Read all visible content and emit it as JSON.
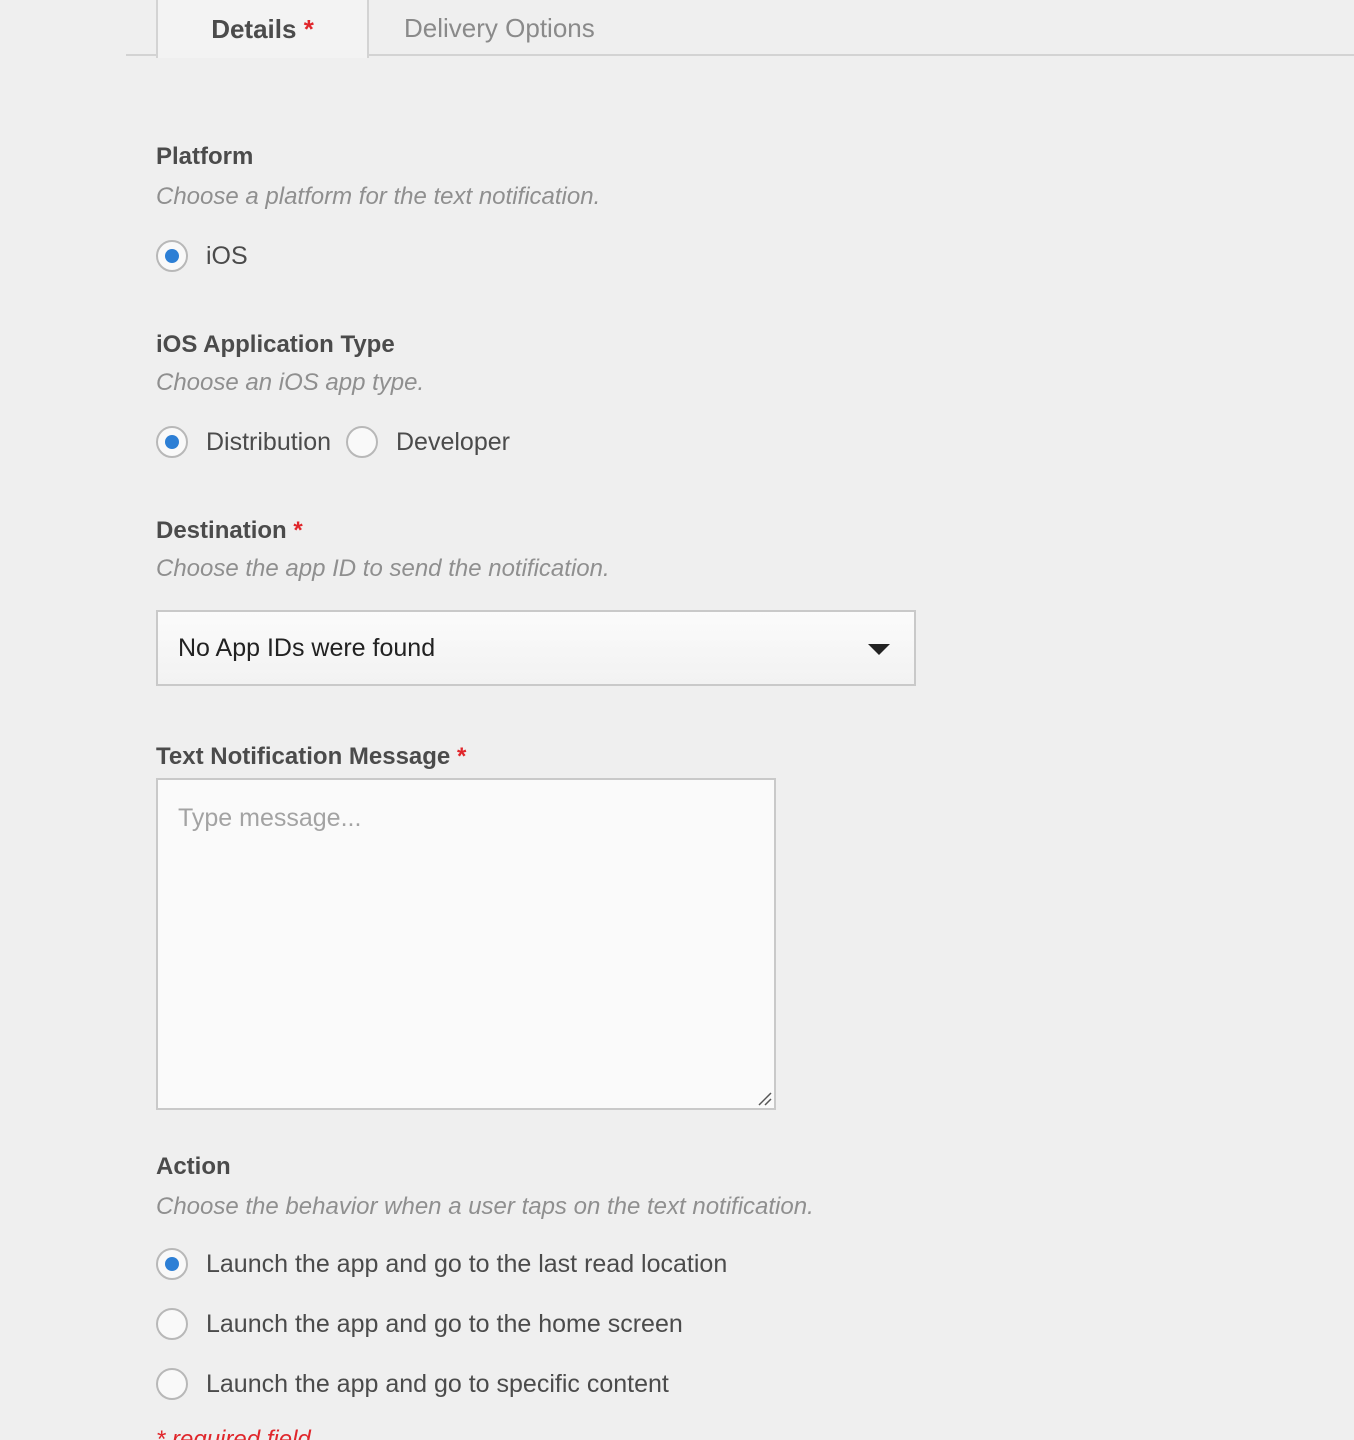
{
  "tabs": {
    "details_label": "Details",
    "details_required": "*",
    "delivery_label": "Delivery Options"
  },
  "platform": {
    "title": "Platform",
    "description": "Choose a platform for the text notification.",
    "options": [
      {
        "label": "iOS",
        "checked": true
      }
    ]
  },
  "app_type": {
    "title": "iOS Application Type",
    "description": "Choose an iOS app type.",
    "options": [
      {
        "label": "Distribution",
        "checked": true
      },
      {
        "label": "Developer",
        "checked": false
      }
    ]
  },
  "destination": {
    "title": "Destination",
    "required": "*",
    "description": "Choose the app ID to send the notification.",
    "selected_value": "No App IDs were found"
  },
  "message": {
    "title": "Text Notification Message",
    "required": "*",
    "value": "",
    "placeholder": "Type message..."
  },
  "action": {
    "title": "Action",
    "description": "Choose the behavior when a user taps on the text notification.",
    "options": [
      {
        "label": "Launch the app and go to the last read location",
        "checked": true
      },
      {
        "label": "Launch the app and go to the home screen",
        "checked": false
      },
      {
        "label": "Launch the app and go to specific content",
        "checked": false
      }
    ]
  },
  "footer": {
    "required_note": "* required field"
  },
  "colors": {
    "accent": "#2d7fd5",
    "required": "#e0262b",
    "background": "#efefef"
  }
}
